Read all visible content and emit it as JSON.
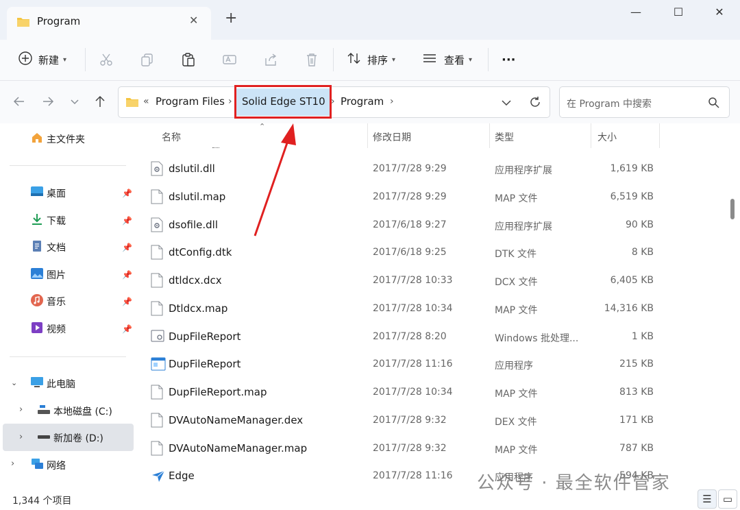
{
  "window": {
    "tab_title": "Program",
    "tab_close": "✕",
    "new_tab": "+",
    "minimize": "—",
    "maximize": "☐",
    "close": "✕"
  },
  "toolbar": {
    "new_label": "新建",
    "sort_label": "排序",
    "view_label": "查看",
    "more_label": "···"
  },
  "address": {
    "overflow": "«",
    "crumbs": [
      "Program Files",
      "Solid Edge ST10",
      "Program"
    ],
    "search_placeholder": "在 Program 中搜索"
  },
  "sidebar": {
    "home": "主文件夹",
    "quick": [
      {
        "label": "桌面",
        "icon": "desktop-icon"
      },
      {
        "label": "下载",
        "icon": "download-icon"
      },
      {
        "label": "文档",
        "icon": "document-icon"
      },
      {
        "label": "图片",
        "icon": "pictures-icon"
      },
      {
        "label": "音乐",
        "icon": "music-icon"
      },
      {
        "label": "视频",
        "icon": "video-icon"
      }
    ],
    "this_pc": "此电脑",
    "drives": [
      "本地磁盘 (C:)",
      "新加卷 (D:)"
    ],
    "network": "网络"
  },
  "columns": {
    "name": "名称",
    "date": "修改日期",
    "type": "类型",
    "size": "大小"
  },
  "files": [
    {
      "name": "dslutil.dll",
      "date": "2017/7/28 9:29",
      "type": "应用程序扩展",
      "size": "1,619 KB",
      "icon": "dll-icon"
    },
    {
      "name": "dslutil.map",
      "date": "2017/7/28 9:29",
      "type": "MAP 文件",
      "size": "6,519 KB",
      "icon": "file-icon"
    },
    {
      "name": "dsofile.dll",
      "date": "2017/6/18 9:27",
      "type": "应用程序扩展",
      "size": "90 KB",
      "icon": "dll-icon"
    },
    {
      "name": "dtConfig.dtk",
      "date": "2017/6/18 9:25",
      "type": "DTK 文件",
      "size": "8 KB",
      "icon": "file-icon"
    },
    {
      "name": "dtldcx.dcx",
      "date": "2017/7/28 10:33",
      "type": "DCX 文件",
      "size": "6,405 KB",
      "icon": "file-icon"
    },
    {
      "name": "Dtldcx.map",
      "date": "2017/7/28 10:34",
      "type": "MAP 文件",
      "size": "14,316 KB",
      "icon": "file-icon"
    },
    {
      "name": "DupFileReport",
      "date": "2017/7/28 8:20",
      "type": "Windows 批处理...",
      "size": "1 KB",
      "icon": "batch-icon"
    },
    {
      "name": "DupFileReport",
      "date": "2017/7/28 11:16",
      "type": "应用程序",
      "size": "215 KB",
      "icon": "app-icon"
    },
    {
      "name": "DupFileReport.map",
      "date": "2017/7/28 10:34",
      "type": "MAP 文件",
      "size": "813 KB",
      "icon": "file-icon"
    },
    {
      "name": "DVAutoNameManager.dex",
      "date": "2017/7/28 9:32",
      "type": "DEX 文件",
      "size": "171 KB",
      "icon": "file-icon"
    },
    {
      "name": "DVAutoNameManager.map",
      "date": "2017/7/28 9:32",
      "type": "MAP 文件",
      "size": "787 KB",
      "icon": "file-icon"
    },
    {
      "name": "Edge",
      "date": "2017/7/28 11:16",
      "type": "应用程序",
      "size": "594 KB",
      "icon": "edge-app-icon"
    }
  ],
  "status": {
    "count": "1,344 个项目"
  },
  "watermark": "公众号 · 最全软件管家",
  "colors": {
    "highlight_box": "#e02020",
    "crumb_selected": "#cce4f7",
    "folder": "#f4c542"
  }
}
